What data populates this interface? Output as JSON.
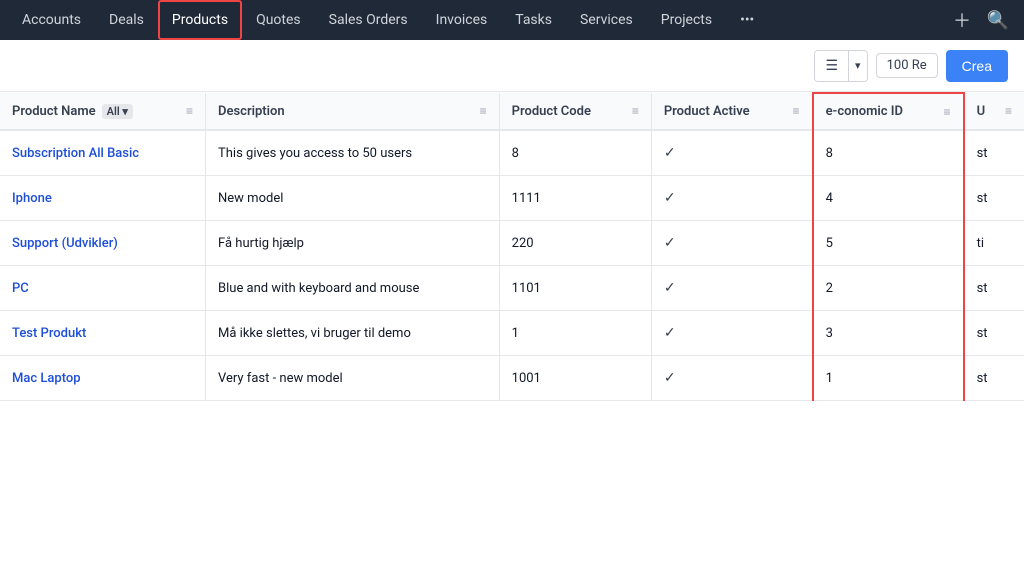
{
  "nav": {
    "items": [
      {
        "label": "Accounts",
        "active": false
      },
      {
        "label": "Deals",
        "active": false
      },
      {
        "label": "Products",
        "active": true
      },
      {
        "label": "Quotes",
        "active": false
      },
      {
        "label": "Sales Orders",
        "active": false
      },
      {
        "label": "Invoices",
        "active": false
      },
      {
        "label": "Tasks",
        "active": false
      },
      {
        "label": "Services",
        "active": false
      },
      {
        "label": "Projects",
        "active": false
      },
      {
        "label": "•••",
        "active": false
      }
    ]
  },
  "toolbar": {
    "records_label": "100 Re",
    "create_label": "Crea"
  },
  "table": {
    "columns": [
      {
        "label": "Product Name",
        "filter": "All",
        "key": "name"
      },
      {
        "label": "Description",
        "key": "description"
      },
      {
        "label": "Product Code",
        "key": "code"
      },
      {
        "label": "Product Active",
        "key": "active"
      },
      {
        "label": "e-conomic ID",
        "key": "economic_id",
        "highlighted": true
      },
      {
        "label": "U",
        "key": "unit"
      }
    ],
    "rows": [
      {
        "name": "Subscription All Basic",
        "description": "This gives you access to 50 users",
        "code": "8",
        "active": true,
        "economic_id": "8",
        "unit": "st"
      },
      {
        "name": "Iphone",
        "description": "New model",
        "code": "1111",
        "active": true,
        "economic_id": "4",
        "unit": "st"
      },
      {
        "name": "Support (Udvikler)",
        "description": "Få hurtig hjælp",
        "code": "220",
        "active": true,
        "economic_id": "5",
        "unit": "ti"
      },
      {
        "name": "PC",
        "description": "Blue and with keyboard and mouse",
        "code": "1101",
        "active": true,
        "economic_id": "2",
        "unit": "st"
      },
      {
        "name": "Test Produkt",
        "description": "Må ikke slettes, vi bruger til demo",
        "code": "1",
        "active": true,
        "economic_id": "3",
        "unit": "st"
      },
      {
        "name": "Mac Laptop",
        "description": "Very fast - new model",
        "code": "1001",
        "active": true,
        "economic_id": "1",
        "unit": "st"
      }
    ]
  }
}
